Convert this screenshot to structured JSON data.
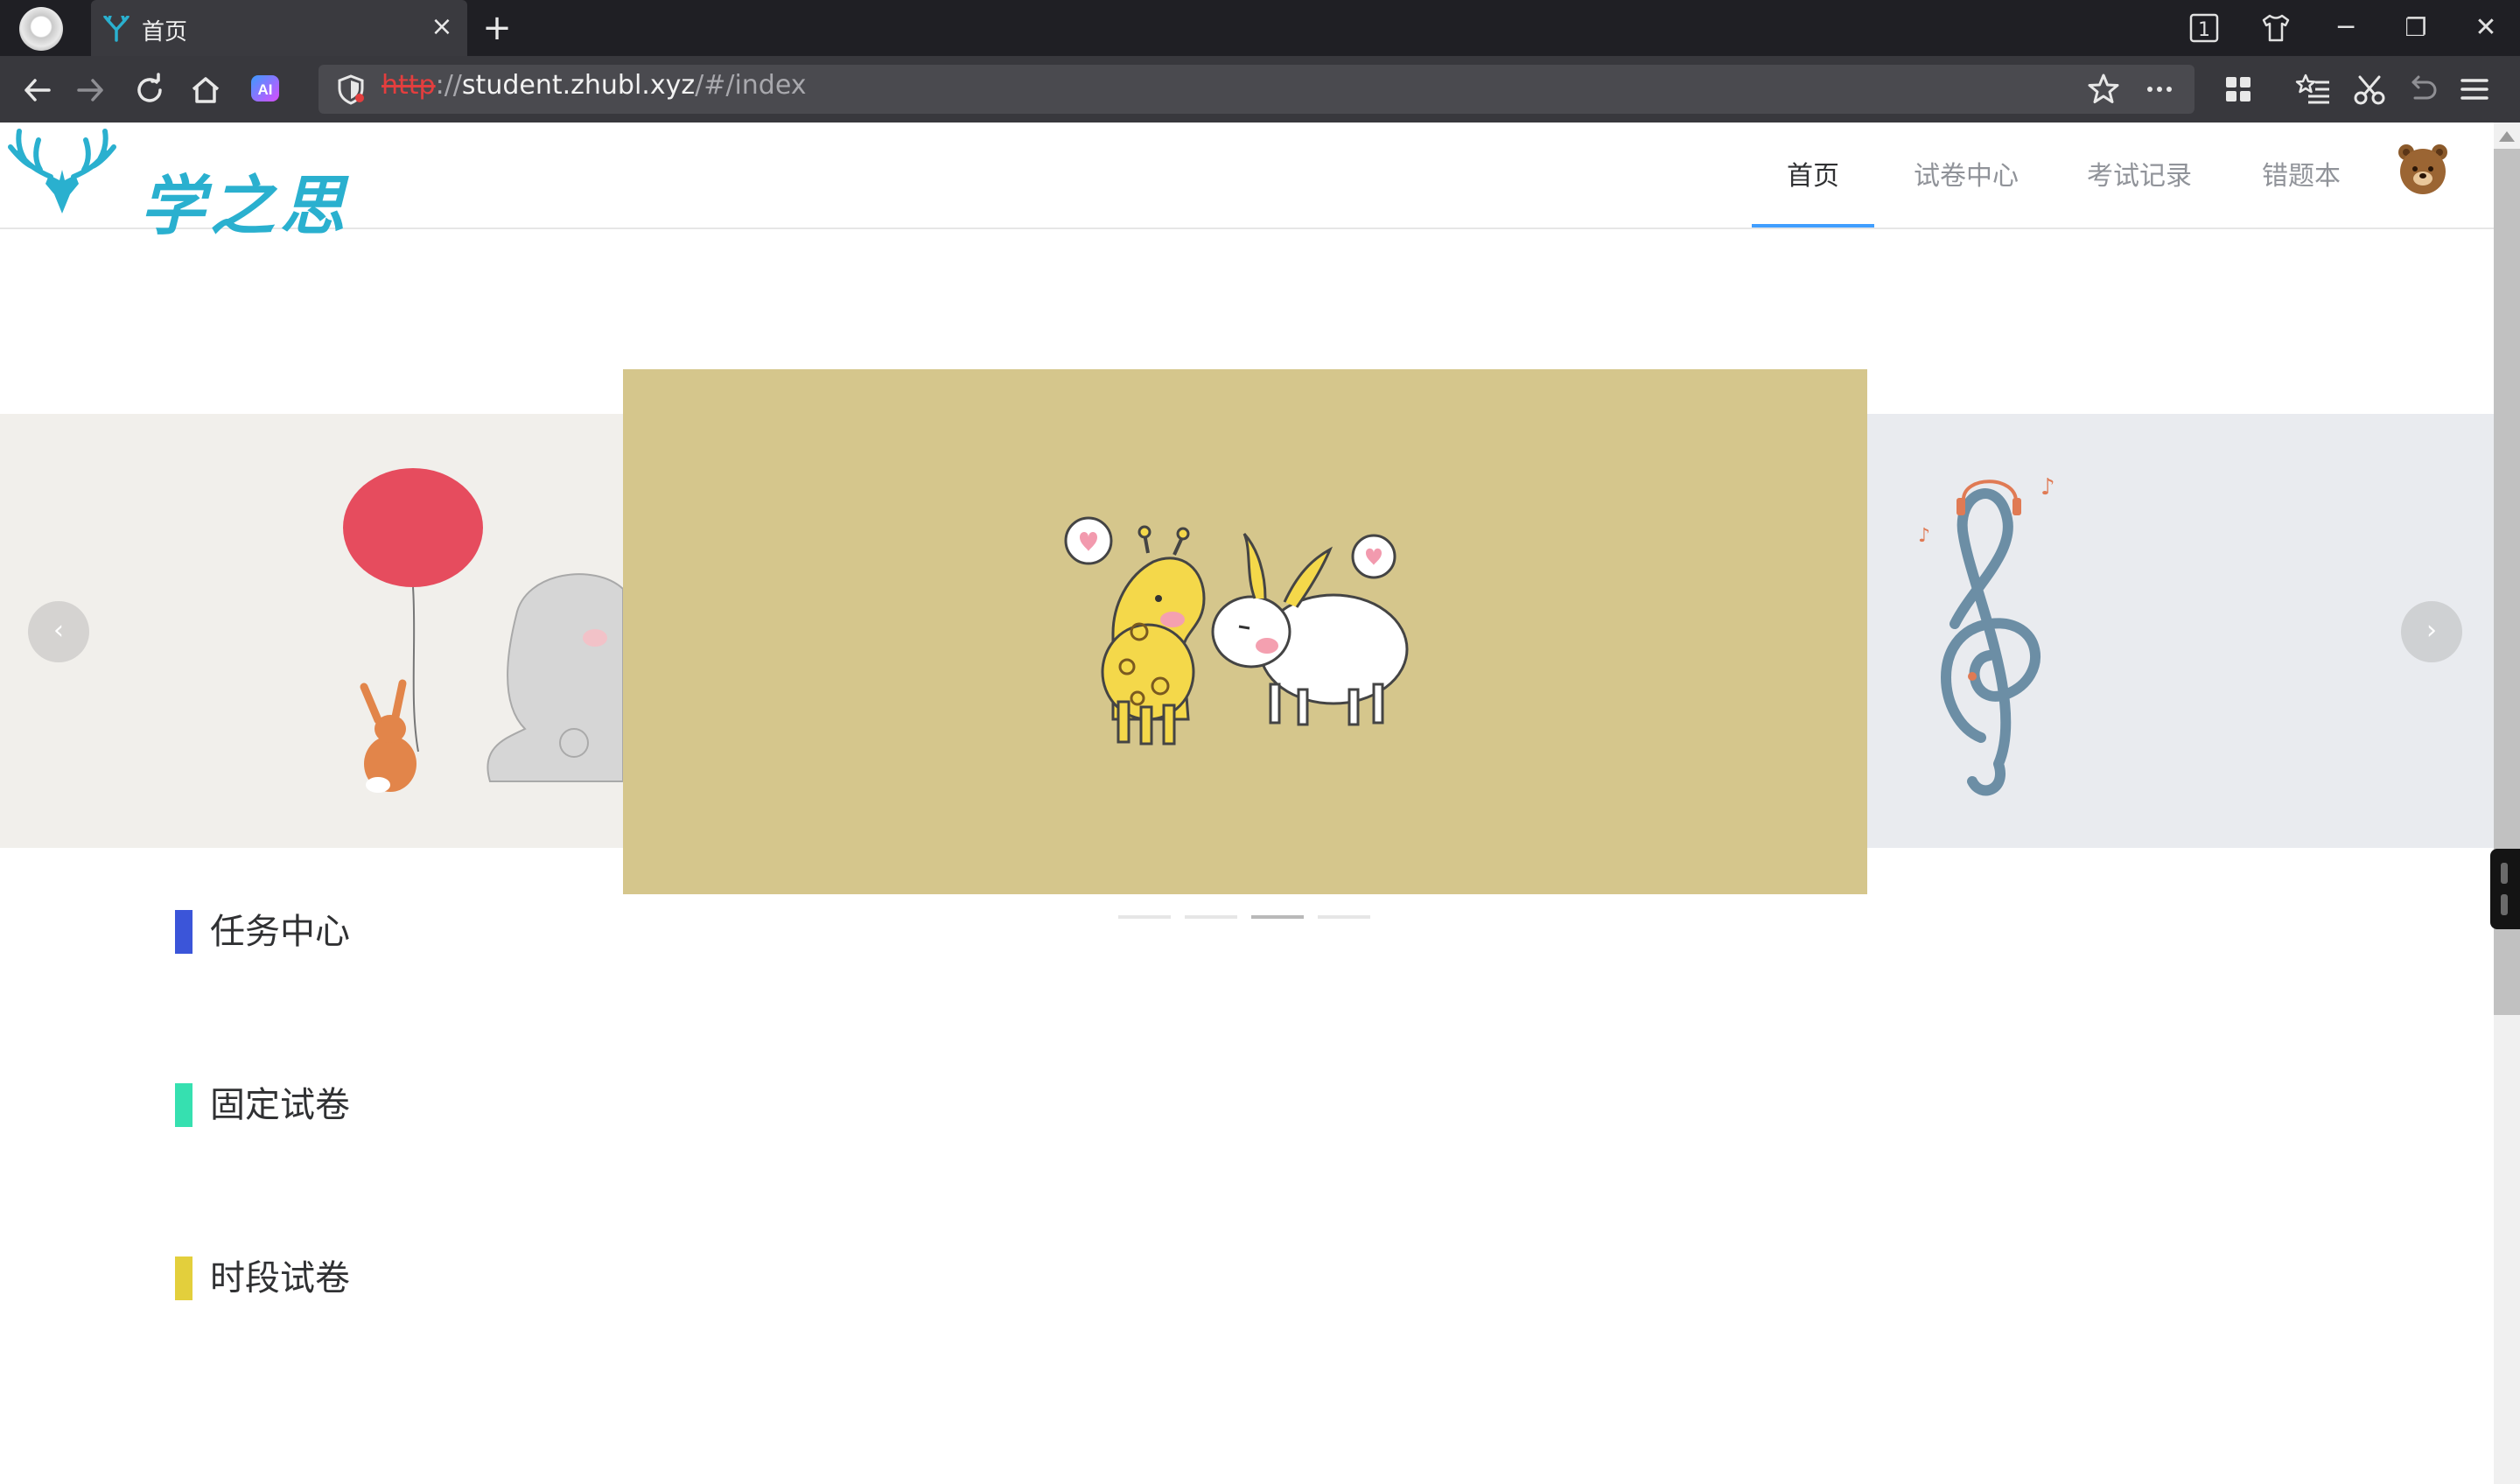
{
  "browser": {
    "tab_title": "首页",
    "tab_close": "×",
    "new_tab": "+",
    "tab_count": "1",
    "url_protocol": "http",
    "url_separator": "://",
    "url_host": "student.zhubl.xyz",
    "url_path": "/#/index",
    "window_controls": {
      "minimize": "─",
      "restore": "❐",
      "close": "✕"
    },
    "accent_color": "#2ab0cf"
  },
  "header": {
    "logo_text": "学之思",
    "menu": [
      {
        "label": "首页",
        "active": true
      },
      {
        "label": "试卷中心",
        "active": false
      },
      {
        "label": "考试记录",
        "active": false
      },
      {
        "label": "错题本",
        "active": false
      }
    ],
    "menu_active_color": "#409eff"
  },
  "carousel": {
    "prev_label": "‹",
    "next_label": "›",
    "slide_count": 4,
    "active_index": 2
  },
  "sections": [
    {
      "title": "任务中心",
      "color": "#3b55d9"
    },
    {
      "title": "固定试卷",
      "color": "#36e0b0"
    },
    {
      "title": "时段试卷",
      "color": "#e3cf3c"
    }
  ]
}
